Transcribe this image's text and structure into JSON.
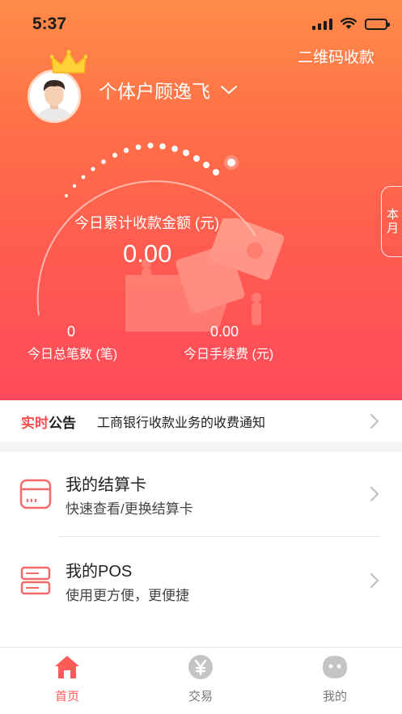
{
  "status_bar": {
    "time": "5:37"
  },
  "header": {
    "qr_link": "二维码收款",
    "user_name": "个体户顾逸飞",
    "month_tab": "本月",
    "today_amount_label": "今日累计收款金额 (元)",
    "today_amount_value": "0.00",
    "total_count_value": "0",
    "total_count_label": "今日总笔数 (笔)",
    "fee_value": "0.00",
    "fee_label": "今日手续费 (元)"
  },
  "notice": {
    "tag_red": "实时",
    "tag_black": "公告",
    "text": "工商银行收款业务的收费通知"
  },
  "menu": {
    "items": [
      {
        "title": "我的结算卡",
        "subtitle": "快速查看/更换结算卡",
        "icon": "card-icon"
      },
      {
        "title": "我的POS",
        "subtitle": "使用更方便，更便捷",
        "icon": "pos-icon"
      }
    ]
  },
  "tabbar": {
    "tabs": [
      {
        "label": "首页",
        "icon": "home-icon",
        "active": true
      },
      {
        "label": "交易",
        "icon": "yen-icon",
        "active": false
      },
      {
        "label": "我的",
        "icon": "profile-icon",
        "active": false
      }
    ]
  },
  "colors": {
    "accent": "#ff5a5a",
    "header_top": "#ff8c48",
    "header_bottom": "#ff4b5b",
    "notice_red": "#ff4c4c"
  }
}
